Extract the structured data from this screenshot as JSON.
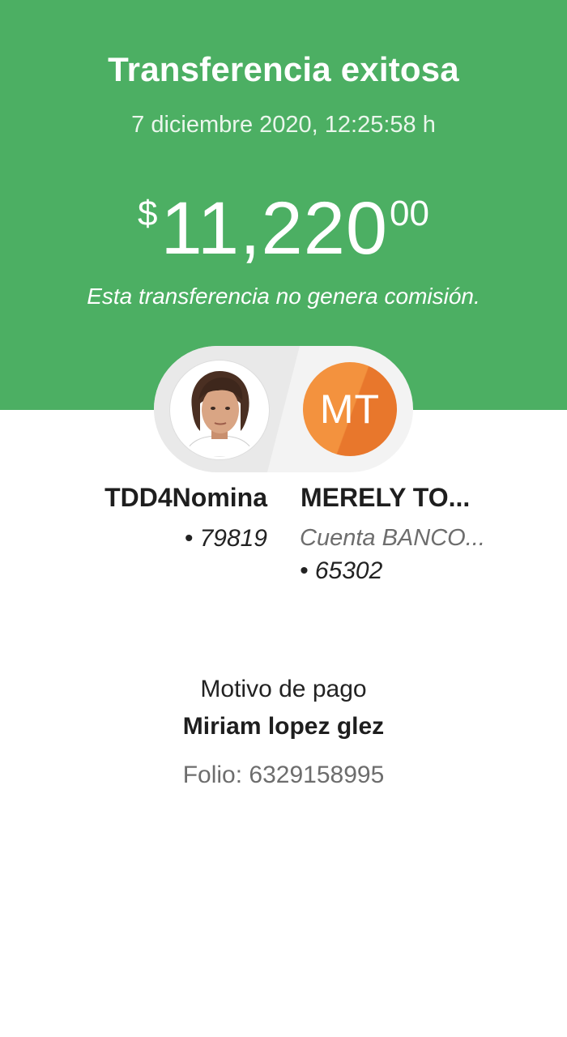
{
  "colors": {
    "header_bg": "#4caf63",
    "avatar_mt": "#f3923e",
    "muted_text": "#6d6d6d"
  },
  "header": {
    "title": "Transferencia exitosa",
    "datetime": "7 diciembre 2020, 12:25:58 h",
    "amount": {
      "currency": "$",
      "integer": "11,220",
      "decimals": "00"
    },
    "commission_note": "Esta transferencia no genera comisión."
  },
  "source_account": {
    "avatar_icon": "person-photo-avatar",
    "name": "TDD4Nomina",
    "account": "• 79819"
  },
  "destination_account": {
    "initials": "MT",
    "name": "MERELY TO...",
    "bank": "Cuenta BANCO...",
    "account": "• 65302"
  },
  "details": {
    "reason_label": "Motivo de pago",
    "reason_value": "Miriam lopez glez",
    "folio": "Folio: 6329158995"
  }
}
